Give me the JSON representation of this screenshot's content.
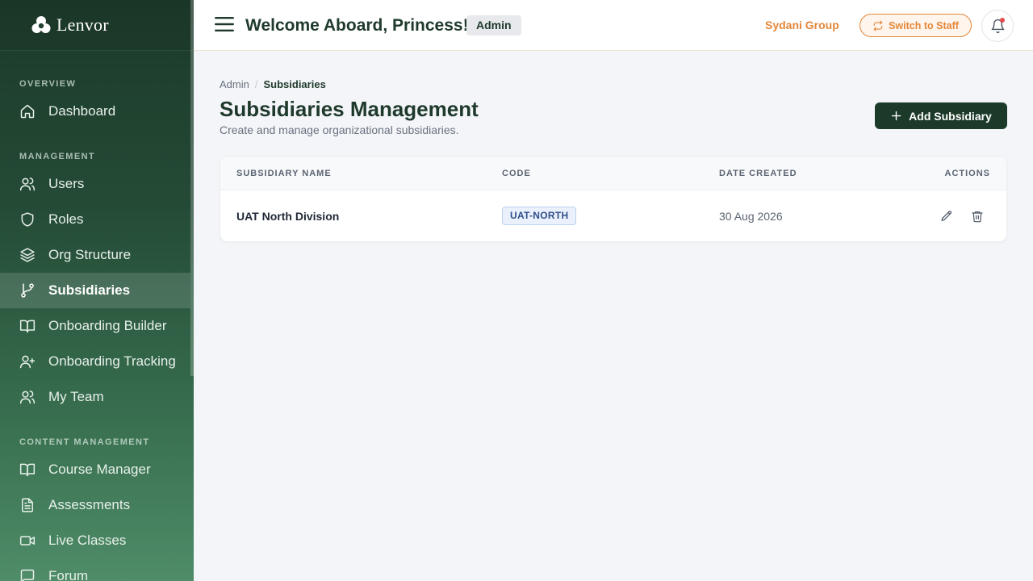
{
  "brand": {
    "name": "Lenvor",
    "logo_icon": "brand-logo"
  },
  "sidebar": {
    "sections": [
      {
        "title": "OVERVIEW"
      },
      {
        "title": "MANAGEMENT"
      },
      {
        "title": "CONTENT MANAGEMENT"
      }
    ],
    "items": [
      {
        "label": "Dashboard",
        "icon": "home-icon"
      },
      {
        "label": "Users",
        "icon": "users-icon"
      },
      {
        "label": "Roles",
        "icon": "shield-icon"
      },
      {
        "label": "Org Structure",
        "icon": "layers-icon"
      },
      {
        "label": "Subsidiaries",
        "icon": "git-branch-icon",
        "active": true
      },
      {
        "label": "Onboarding Builder",
        "icon": "book-open-icon"
      },
      {
        "label": "Onboarding Tracking",
        "icon": "user-plus-icon"
      },
      {
        "label": "My Team",
        "icon": "users-icon"
      },
      {
        "label": "Course Manager",
        "icon": "book-open-icon"
      },
      {
        "label": "Assessments",
        "icon": "file-text-icon"
      },
      {
        "label": "Live Classes",
        "icon": "video-icon"
      },
      {
        "label": "Forum",
        "icon": "message-square-icon"
      }
    ]
  },
  "header": {
    "welcome": "Welcome Aboard, Princess!",
    "role_badge": "Admin",
    "org_name": "Sydani Group",
    "switch_label": "Switch to Staff",
    "has_notification": true
  },
  "breadcrumb": {
    "root": "Admin",
    "separator": "/",
    "current": "Subsidiaries"
  },
  "page": {
    "title": "Subsidiaries Management",
    "subtitle": "Create and manage organizational subsidiaries.",
    "add_button_label": "Add Subsidiary"
  },
  "table": {
    "columns": [
      "SUBSIDIARY NAME",
      "CODE",
      "DATE CREATED",
      "ACTIONS"
    ],
    "rows": [
      {
        "name": "UAT North Division",
        "code": "UAT-NORTH",
        "date_created": "30 Aug 2026"
      }
    ]
  },
  "colors": {
    "sidebar_dark": "#1c3a2a",
    "accent_orange": "#e3873a",
    "primary_button": "#1c3a2a",
    "code_badge_text": "#2f4e8a"
  }
}
